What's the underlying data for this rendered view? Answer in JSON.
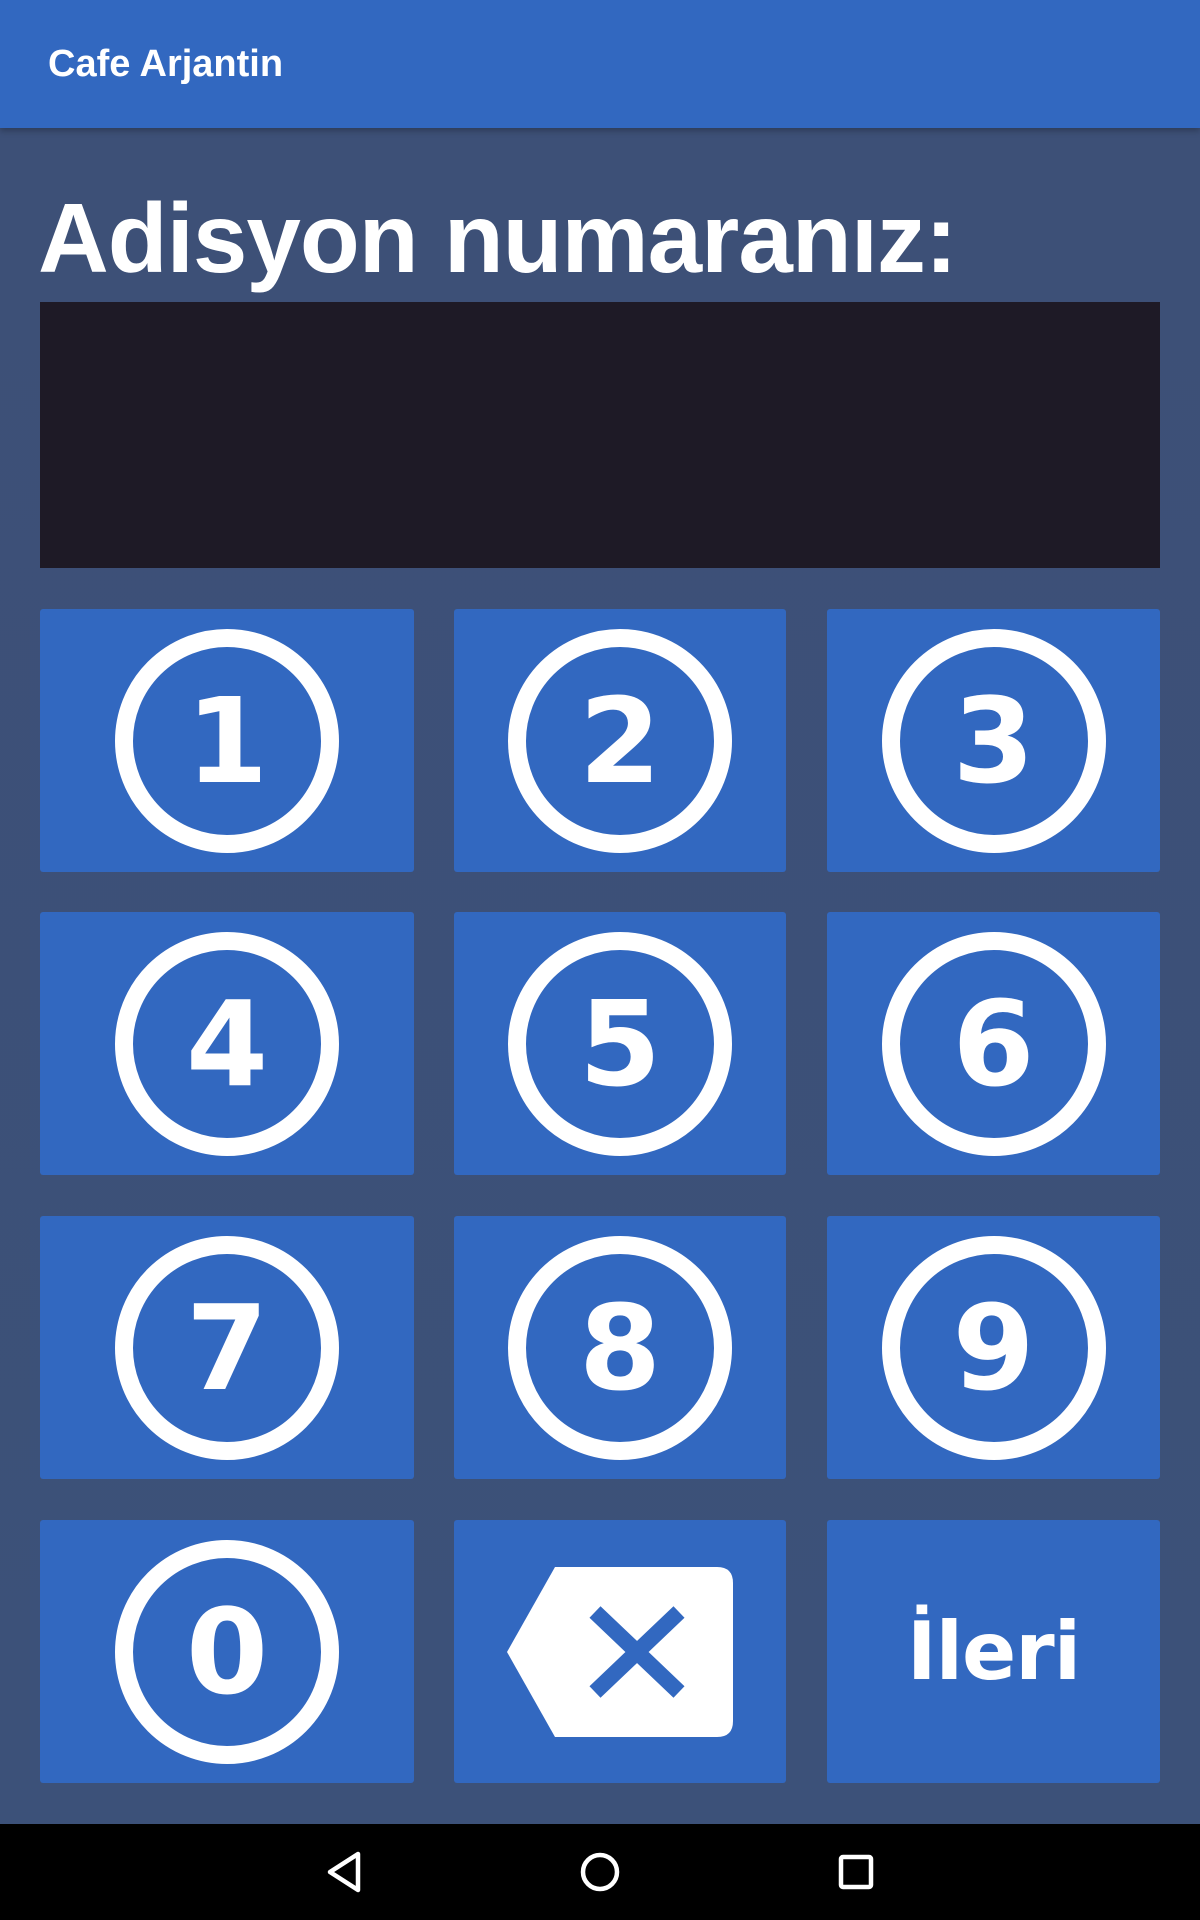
{
  "app_bar": {
    "title": "Cafe Arjantin"
  },
  "main": {
    "prompt": "Adisyon numaranız:",
    "display_value": ""
  },
  "keypad": {
    "keys": [
      {
        "label": "1",
        "icon": "circled-digit-1-icon"
      },
      {
        "label": "2",
        "icon": "circled-digit-2-icon"
      },
      {
        "label": "3",
        "icon": "circled-digit-3-icon"
      },
      {
        "label": "4",
        "icon": "circled-digit-4-icon"
      },
      {
        "label": "5",
        "icon": "circled-digit-5-icon"
      },
      {
        "label": "6",
        "icon": "circled-digit-6-icon"
      },
      {
        "label": "7",
        "icon": "circled-digit-7-icon"
      },
      {
        "label": "8",
        "icon": "circled-digit-8-icon"
      },
      {
        "label": "9",
        "icon": "circled-digit-9-icon"
      },
      {
        "label": "0",
        "icon": "circled-digit-0-icon"
      }
    ],
    "backspace_icon": "backspace-icon",
    "next_label": "İleri"
  },
  "nav_bar": {
    "icons": [
      "back-triangle-icon",
      "home-circle-icon",
      "recents-square-icon"
    ]
  },
  "colors": {
    "primary": "#3268c0",
    "background": "#3d5179",
    "display_bg": "#1e1a26",
    "foreground": "#ffffff",
    "nav_bar": "#000000"
  }
}
